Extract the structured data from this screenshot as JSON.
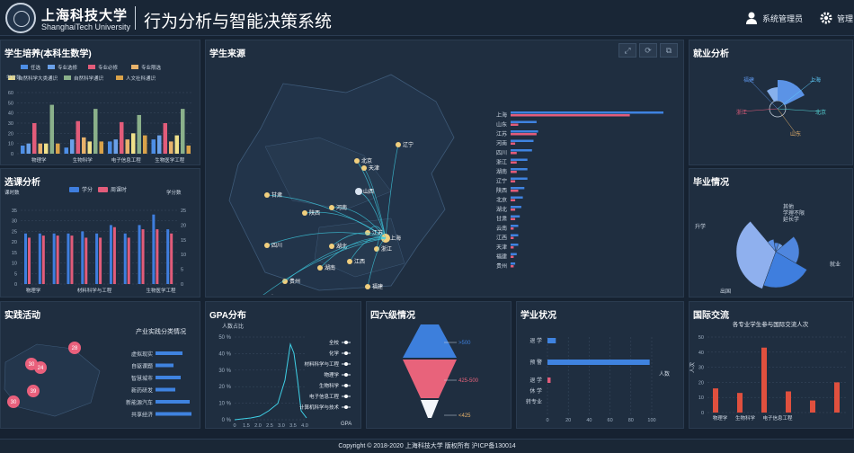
{
  "header": {
    "school_cn": "上海科技大学",
    "school_en": "ShanghaiTech University",
    "title": "行为分析与智能决策系统",
    "user": "系统管理员",
    "manage": "管理"
  },
  "footer": "Copyright © 2018-2020 上海科技大学 版权所有 沪ICP备130014",
  "panels": {
    "p1": "学生培养(本科生数学)",
    "p2": "学生来源",
    "p3": "就业分析",
    "p4": "选课分析",
    "p5": "毕业情况",
    "p6": "实践活动",
    "p7": "GPA分布",
    "p8": "四六级情况",
    "p9": "学业状况",
    "p10": "国际交流"
  },
  "training": {
    "unit": "学分数",
    "legend": [
      "任选",
      "专业选修",
      "专业必修",
      "专业限选",
      "自然科学大类通识",
      "自然科学通识",
      "人文社科通识"
    ],
    "colors": [
      "#4d8ee6",
      "#6aa0e8",
      "#e25c7a",
      "#e7b26b",
      "#efe08a",
      "#8ab08a",
      "#d9a24a"
    ],
    "categories": [
      "物理学",
      "生物科学",
      "电子信息工程",
      "生物医学工程"
    ],
    "ylim": [
      0,
      60
    ],
    "yticks": [
      "0",
      "10",
      "20",
      "30",
      "40",
      "50",
      "60"
    ],
    "values": [
      [
        8,
        10,
        30,
        10,
        10,
        48,
        10
      ],
      [
        6,
        14,
        32,
        16,
        12,
        44,
        12
      ],
      [
        12,
        14,
        31,
        14,
        20,
        38,
        18
      ],
      [
        14,
        18,
        30,
        12,
        18,
        44,
        8
      ]
    ]
  },
  "course": {
    "legend": [
      "学分",
      "周课时"
    ],
    "colors": [
      "#3f7ede",
      "#e25c7a"
    ],
    "left_unit": "课时数",
    "right_unit": "学分数",
    "left_ticks": [
      "0",
      "5",
      "10",
      "15",
      "20",
      "25",
      "30",
      "35"
    ],
    "right_ticks": [
      "0",
      "5",
      "10",
      "15",
      "20",
      "25"
    ],
    "categories": [
      "物理学",
      "材料科学与工程",
      "生物医学工程"
    ],
    "values": [
      [
        24,
        22
      ],
      [
        24,
        23
      ],
      [
        24,
        23
      ],
      [
        24,
        23
      ],
      [
        25,
        22
      ],
      [
        24,
        22
      ],
      [
        28,
        27
      ],
      [
        24,
        22
      ],
      [
        28,
        26
      ],
      [
        33,
        26
      ],
      [
        26,
        24
      ]
    ]
  },
  "source": {
    "provinces": [
      "上海",
      "山东",
      "江苏",
      "河南",
      "四川",
      "浙江",
      "湖南",
      "辽宁",
      "陕西",
      "北京",
      "湖北",
      "甘肃",
      "云南",
      "江西",
      "天津",
      "福建",
      "贵州"
    ],
    "values": [
      [
        100,
        78
      ],
      [
        17,
        5
      ],
      [
        18,
        17
      ],
      [
        15,
        3
      ],
      [
        14,
        4
      ],
      [
        11,
        4
      ],
      [
        11,
        4
      ],
      [
        11,
        3
      ],
      [
        9,
        5
      ],
      [
        8,
        3
      ],
      [
        7,
        3
      ],
      [
        6,
        3
      ],
      [
        5,
        2
      ],
      [
        5,
        2
      ],
      [
        5,
        2
      ],
      [
        4,
        2
      ],
      [
        3,
        2
      ]
    ],
    "cities": [
      "北京",
      "天津",
      "山西",
      "辽宁",
      "甘肃",
      "陕西",
      "河南",
      "江苏",
      "上海",
      "四川",
      "湖北",
      "浙江",
      "江西",
      "湖南",
      "贵州",
      "福建",
      "云南"
    ],
    "toolbar": [
      "⤢",
      "⟳",
      "⧉"
    ]
  },
  "employment": {
    "labels": [
      "福建",
      "上海",
      "北京",
      "山东",
      "浙江"
    ],
    "values": [
      40,
      70,
      20,
      10,
      15
    ]
  },
  "graduation": {
    "labels": [
      "升学",
      "其他",
      "学理不限",
      "延长学",
      "就业",
      "出国"
    ],
    "values": [
      30,
      5,
      5,
      5,
      30,
      25
    ]
  },
  "practice": {
    "subtitle": "产业实践分类情况",
    "categories": [
      "虚拟现实",
      "自驱课题",
      "智慧城市",
      "新药研发",
      "新能源汽车",
      "共享经济"
    ],
    "values": [
      30,
      20,
      28,
      22,
      38,
      40
    ],
    "pins": [
      "28",
      "30",
      "24",
      "39",
      "30"
    ]
  },
  "gpa": {
    "unit": "人数占比",
    "yticks": [
      "0 %",
      "10 %",
      "20 %",
      "30 %",
      "40 %",
      "50 %"
    ],
    "xticks": [
      "0",
      "1.5",
      "2.0",
      "2.5",
      "3.0",
      "3.5",
      "4.0"
    ],
    "xlabel": "GPA",
    "legend": [
      "全校",
      "化学",
      "材料科学与工程",
      "物理学",
      "生物科学",
      "电子信息工程",
      "计算机科学与技术"
    ]
  },
  "cet": {
    "labels": [
      ">500",
      "425-500",
      "<425"
    ],
    "colors": [
      "#3d7fdc",
      "#e8637b",
      "#f3f6fa"
    ]
  },
  "academic": {
    "categories": [
      "退 学",
      "预 警",
      "退 学",
      "休 学",
      "转专业"
    ],
    "values": [
      8,
      98,
      3,
      0,
      0
    ],
    "xticks": [
      "0",
      "20",
      "40",
      "60",
      "80",
      "100"
    ],
    "unit": "人数"
  },
  "exchange": {
    "subtitle": "各专业学生参与国际交流人次",
    "ylabel": "人次",
    "categories": [
      "物理学",
      "生物科学",
      "电子信息工程"
    ],
    "values": [
      16,
      13,
      43,
      14,
      8,
      20
    ],
    "ylim": [
      0,
      50
    ],
    "yticks": [
      "0",
      "10",
      "20",
      "30",
      "40",
      "50"
    ]
  }
}
